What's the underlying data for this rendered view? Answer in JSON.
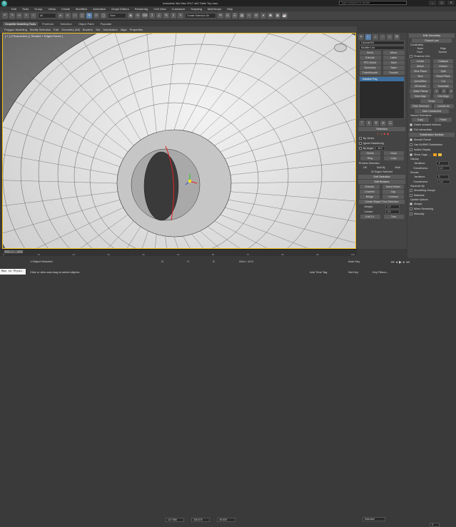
{
  "app": {
    "logo": "S",
    "title": "Autodesk 3ds Max 2017 x64   Table Top.max"
  },
  "search": {
    "placeholder": "Type a keyword or phrase"
  },
  "window_buttons": [
    "_",
    "▢",
    "✕"
  ],
  "menu": [
    "Edit",
    "Tools",
    "Group",
    "Views",
    "Create",
    "Modifiers",
    "Animation",
    "Graph Editors",
    "Rendering",
    "Civil View",
    "Customize",
    "Scripting",
    "MAXScript",
    "Help"
  ],
  "toolbar": {
    "filter_select": "All",
    "view_select": "View",
    "selection_set": "Create Selection Se"
  },
  "ribbon": {
    "tabs": [
      "Graphite Modeling Tools",
      "Freeform",
      "Selection",
      "Object Paint",
      "Populate"
    ]
  },
  "subtabs": [
    "Polygon Modeling",
    "Modify Selection",
    "Edit",
    "Geometry (All)",
    "Borders",
    "Tris",
    "Subdivision",
    "Align",
    "Properties"
  ],
  "viewport": {
    "label": "[ + ] [ Perspective ] [ Shaded + Edged Faces ]"
  },
  "command_panel": {
    "object_name": "Cylinder011",
    "modifier_list": "Modifier List",
    "mod_buttons": [
      [
        "Bend",
        "Mirror"
      ],
      [
        "Extrude",
        "Lathe"
      ],
      [
        "FFD 3x3x3",
        "Shell"
      ],
      [
        "Symmetry",
        "Taper"
      ],
      [
        "TurboSmooth",
        "Smooth"
      ]
    ],
    "stack_item": "Editable Poly",
    "selection_head": "Selection",
    "by_vertex": "By Vertex",
    "ignore_backfacing": "Ignore Backfacing",
    "by_angle": "By Angle:",
    "by_angle_value": "45.0",
    "shrink": "Shrink",
    "grow": "Grow",
    "ring": "Ring",
    "loop": "Loop",
    "preview_selection": "Preview Selection",
    "preview_opts": [
      "Off",
      "SubObj",
      "Multi"
    ],
    "selected_text": "32 Edges Selected",
    "soft_selection": "Soft Selection",
    "edit_borders": "Edit Borders",
    "extrude": "Extrude",
    "insert_vertex": "Insert Vertex",
    "chamfer": "Chamfer",
    "cap": "Cap",
    "bridge": "Bridge",
    "connect": "Connect",
    "create_shape": "Create Shape From Selection",
    "weight_label": "Weight:",
    "weight_value": "1.0",
    "crease_label": "Crease:",
    "crease_value": "0.0",
    "edit_tri": "Edit Tri.",
    "turn": "Turn"
  },
  "right_panel": {
    "edit_geometry": "Edit Geometry",
    "repeat_last": "Repeat Last",
    "constraints": "Constraints",
    "constraint_opts": [
      "None",
      "Edge",
      "Face",
      "Normal"
    ],
    "preserve_uvs": "Preserve UVs",
    "create": "Create",
    "collapse": "Collapse",
    "attach": "Attach",
    "detach": "Detach",
    "slice_plane": "Slice Plane",
    "split": "Split",
    "slice": "Slice",
    "reset_plane": "Reset Plane",
    "quickslice": "QuickSlice",
    "cut": "Cut",
    "msmooth": "MSmooth",
    "tessellate": "Tessellate",
    "make_planar": "Make Planar",
    "make_planar_axes": [
      "X",
      "Y",
      "Z"
    ],
    "view_align": "View Align",
    "grid_align": "Grid Align",
    "relax": "Relax",
    "hide_selected": "Hide Selected",
    "unhide_all": "Unhide All",
    "hide_unselected": "Hide Unselected",
    "named_selections": "Named Selections:",
    "copy": "Copy",
    "paste": "Paste",
    "delete_isolated": "Delete Isolated Vertices",
    "full_interactivity": "Full Interactivity",
    "subdivision_surface": "Subdivision Surface",
    "smooth_result": "Smooth Result",
    "use_nurms": "Use NURMS Subdivision",
    "isoline_display": "Isoline Display",
    "show_cage": "Show Cage......",
    "display": "Display",
    "iterations_label": "Iterations:",
    "iterations_value": "1",
    "smoothness_label": "Smoothness:",
    "smoothness_value": "1.0",
    "render": "Render",
    "r_iterations_value": "0",
    "r_smoothness_value": "1.0",
    "separate_by": "Separate By",
    "smoothing_groups": "Smoothing Groups",
    "materials": "Materials",
    "update_options": "Update Options",
    "always": "Always",
    "when_rendering": "When Rendering",
    "manually": "Manually",
    "cage_colors": [
      "#f0a020",
      "#e8c040"
    ]
  },
  "timeline": {
    "position": "0 / 100",
    "ticks": [
      "0",
      "10",
      "20",
      "30",
      "40",
      "50",
      "60",
      "70",
      "80",
      "90",
      "100"
    ],
    "progress_fraction": 0
  },
  "status": {
    "objects_selected": "1 Object Selected",
    "prompt": "Click or click-and-drag to select objects",
    "x_label": "X:",
    "x_value": "147.656",
    "y_label": "Y:",
    "y_value": "236.576",
    "z_label": "Z:",
    "z_value": "45.635",
    "grid": "Grid = 10.0",
    "add_time_tag": "Add Time Tag",
    "auto_key": "Auto Key",
    "selected": "Selected",
    "set_key": "Set Key",
    "key_filters": "Key Filters...",
    "frame": "0",
    "script_label": "Max to Physc."
  }
}
